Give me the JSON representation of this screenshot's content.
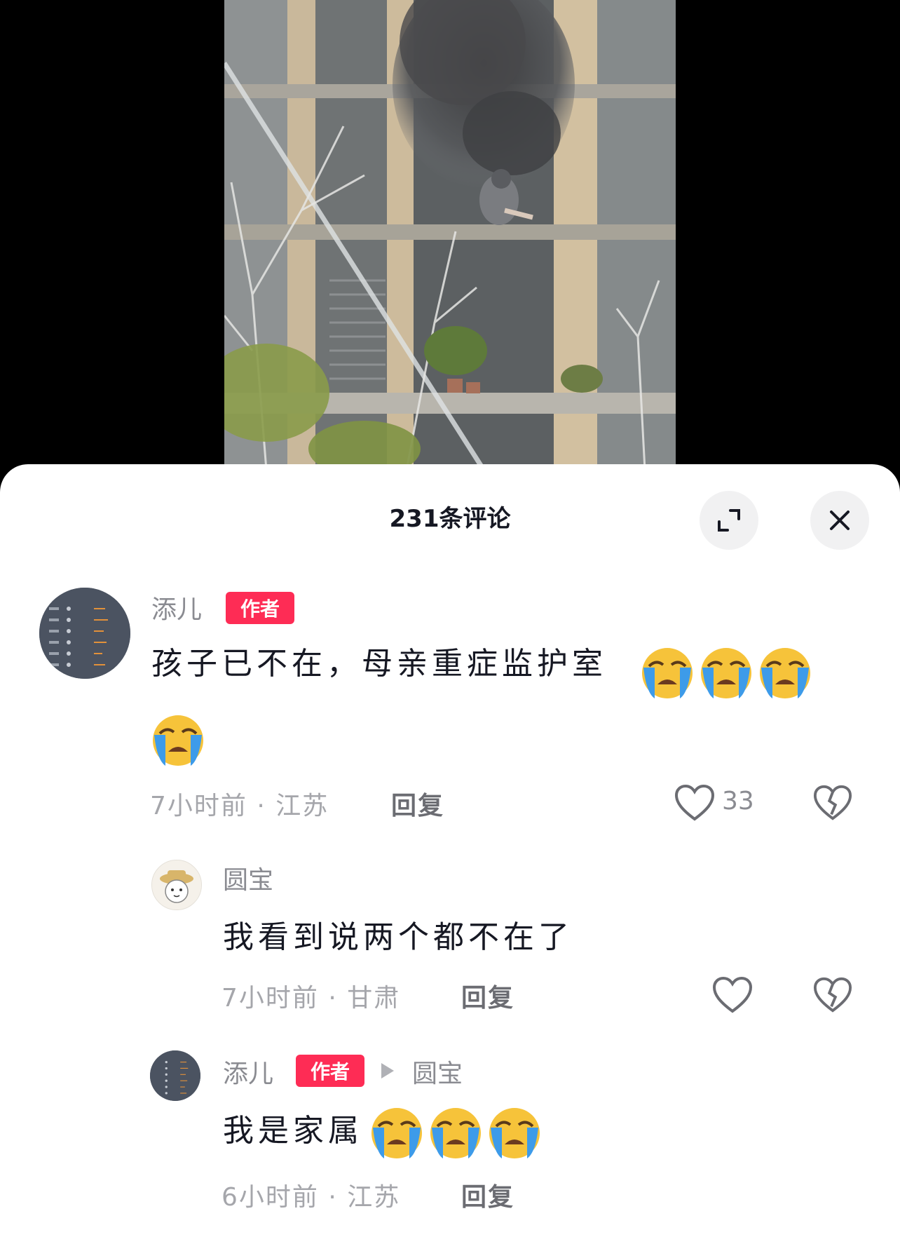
{
  "sheet": {
    "title": "231条评论"
  },
  "comments": [
    {
      "user": "添儿",
      "badge": "作者",
      "text": "孩子已不在，母亲重症监护室",
      "time_location": "7小时前 · 江苏",
      "reply_label": "回复",
      "likes": "33",
      "emoji": "loudly-crying-face-icon",
      "emoji_count": 4
    },
    {
      "user": "圆宝",
      "text": "我看到说两个都不在了",
      "time_location": "7小时前 · 甘肃",
      "reply_label": "回复"
    },
    {
      "user": "添儿",
      "badge": "作者",
      "reply_to": "圆宝",
      "text": "我是家属",
      "time_location": "6小时前 · 江苏",
      "reply_label": "回复",
      "emoji": "loudly-crying-face-icon",
      "emoji_count": 3
    }
  ],
  "colors": {
    "badge": "#fe2c55",
    "emoji_face": "#f6c33a",
    "tears": "#3d9be9"
  }
}
